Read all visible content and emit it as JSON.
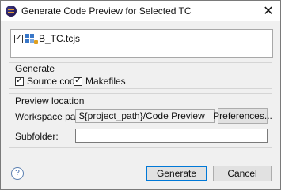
{
  "window": {
    "title": "Generate Code Preview for Selected TC"
  },
  "tree": {
    "items": [
      {
        "label": "B_TC.tcjs",
        "checked": true
      }
    ]
  },
  "generate_group": {
    "title": "Generate",
    "source_code_label": "Source code",
    "makefiles_label": "Makefiles"
  },
  "preview_group": {
    "title": "Preview location",
    "workspace_label": "Workspace path:",
    "workspace_value": "${project_path}/Code Preview",
    "preferences_label": "Preferences...",
    "subfolder_label": "Subfolder:",
    "subfolder_value": ""
  },
  "footer": {
    "help_glyph": "?",
    "generate_label": "Generate",
    "cancel_label": "Cancel"
  },
  "icons": {
    "window": "eclipse-icon",
    "close": "close-icon",
    "file": "tcjs-file-icon",
    "help": "help-icon"
  },
  "check_glyph": "✓",
  "close_glyph": "✕"
}
